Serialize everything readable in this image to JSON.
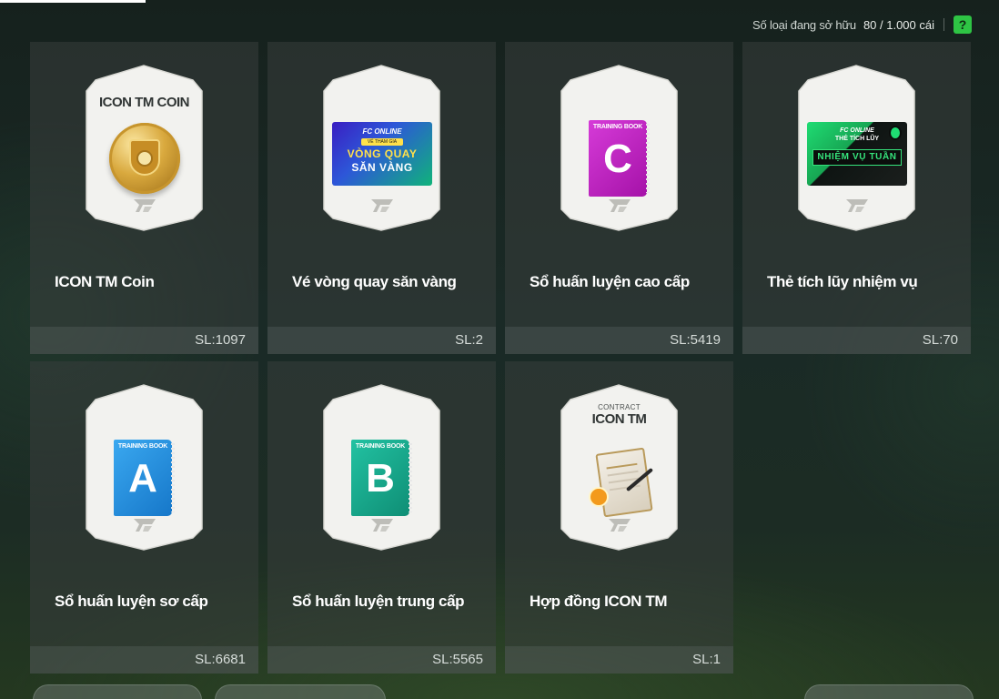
{
  "owned": {
    "label": "Số loại đang sở hữu",
    "value": "80 / 1.000 cái",
    "help": "?"
  },
  "items": [
    {
      "name": "ICON TM Coin",
      "qty": "SL:1097",
      "art_title": "ICON TM COIN"
    },
    {
      "name": "Vé vòng quay săn vàng",
      "qty": "SL:2",
      "banner": {
        "brand": "FC ONLINE",
        "tag": "VÉ THAM GIA",
        "line1": "VÒNG QUAY",
        "line2": "SĂN VÀNG"
      }
    },
    {
      "name": "Sổ huấn luyện cao cấp",
      "qty": "SL:5419",
      "book": {
        "label": "TRAINING BOOK",
        "letter": "C"
      }
    },
    {
      "name": "Thẻ tích lũy nhiệm vụ",
      "qty": "SL:70",
      "banner": {
        "brand": "FC ONLINE",
        "tag": "THẺ TÍCH LŨY",
        "line1": "NHIỆM VỤ TUẦN"
      }
    },
    {
      "name": "Sổ huấn luyện sơ cấp",
      "qty": "SL:6681",
      "book": {
        "label": "TRAINING BOOK",
        "letter": "A"
      }
    },
    {
      "name": "Sổ huấn luyện trung cấp",
      "qty": "SL:5565",
      "book": {
        "label": "TRAINING BOOK",
        "letter": "B"
      }
    },
    {
      "name": "Hợp đồng ICON TM",
      "qty": "SL:1",
      "art_sub": "CONTRACT",
      "art_title": "ICON TM"
    }
  ],
  "colors": {
    "accent_green": "#2ec444",
    "book_c": "#c21fc4",
    "book_a": "#1f9ae8",
    "book_b": "#17a88c"
  }
}
